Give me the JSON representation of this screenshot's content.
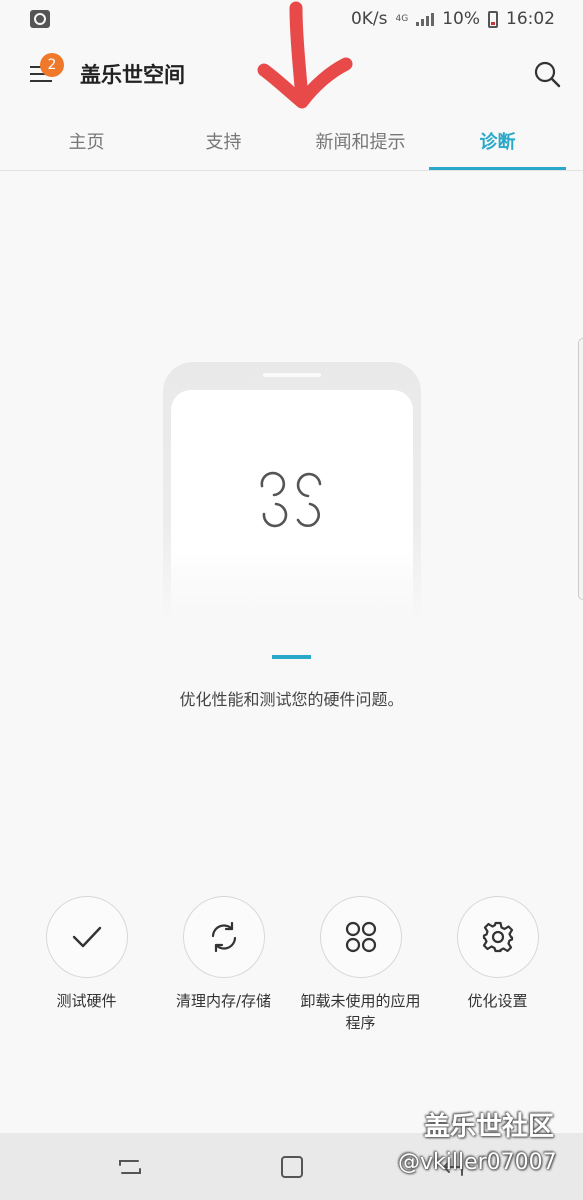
{
  "status_bar": {
    "speed": "0K/s",
    "network": "4G",
    "battery": "10%",
    "time": "16:02"
  },
  "header": {
    "menu_badge": "2",
    "title": "盖乐世空间"
  },
  "tabs": [
    {
      "label": "主页",
      "active": false
    },
    {
      "label": "支持",
      "active": false
    },
    {
      "label": "新闻和提示",
      "active": false
    },
    {
      "label": "诊断",
      "active": true
    }
  ],
  "main": {
    "description": "优化性能和测试您的硬件问题。"
  },
  "actions": [
    {
      "label": "测试硬件",
      "icon": "check-icon"
    },
    {
      "label": "清理内存/存储",
      "icon": "refresh-icon"
    },
    {
      "label": "卸载未使用的应用程序",
      "icon": "apps-grid-icon"
    },
    {
      "label": "优化设置",
      "icon": "gear-icon"
    }
  ],
  "watermark": {
    "site": "盖乐世社区",
    "user": "@vkiller07007"
  },
  "colors": {
    "accent": "#2aa8c9",
    "badge": "#f0782a",
    "annotation_arrow": "#e84a4a"
  }
}
